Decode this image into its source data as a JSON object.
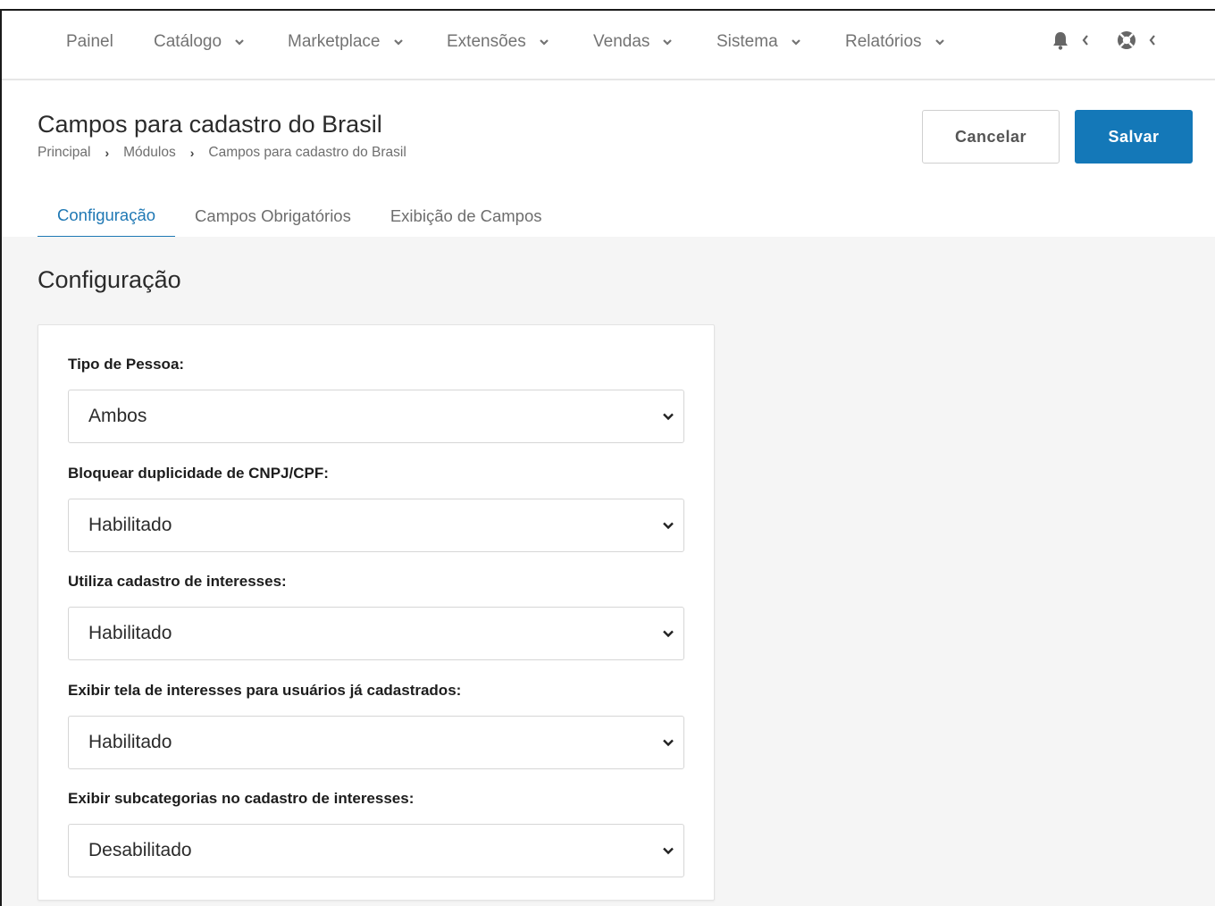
{
  "nav": {
    "items": [
      {
        "label": "Painel",
        "dropdown": false
      },
      {
        "label": "Catálogo",
        "dropdown": true
      },
      {
        "label": "Marketplace",
        "dropdown": true
      },
      {
        "label": "Extensões",
        "dropdown": true
      },
      {
        "label": "Vendas",
        "dropdown": true
      },
      {
        "label": "Sistema",
        "dropdown": true
      },
      {
        "label": "Relatórios",
        "dropdown": true
      }
    ],
    "icons": [
      "bell-icon",
      "life-ring-icon"
    ]
  },
  "header": {
    "title": "Campos para cadastro do Brasil",
    "breadcrumb": [
      "Principal",
      "Módulos",
      "Campos para cadastro do Brasil"
    ],
    "cancel_label": "Cancelar",
    "save_label": "Salvar"
  },
  "tabs": [
    {
      "label": "Configuração",
      "active": true
    },
    {
      "label": "Campos Obrigatórios",
      "active": false
    },
    {
      "label": "Exibição de Campos",
      "active": false
    }
  ],
  "section": {
    "title": "Configuração"
  },
  "form": {
    "fields": [
      {
        "label": "Tipo de Pessoa:",
        "value": "Ambos"
      },
      {
        "label": "Bloquear duplicidade de CNPJ/CPF:",
        "value": "Habilitado"
      },
      {
        "label": "Utiliza cadastro de interesses:",
        "value": "Habilitado"
      },
      {
        "label": "Exibir tela de interesses para usuários já cadastrados:",
        "value": "Habilitado"
      },
      {
        "label": "Exibir subcategorias no cadastro de interesses:",
        "value": "Desabilitado"
      }
    ]
  },
  "colors": {
    "accent": "#1478b8",
    "tab_active": "#1f78b4",
    "content_bg": "#f5f5f5"
  }
}
